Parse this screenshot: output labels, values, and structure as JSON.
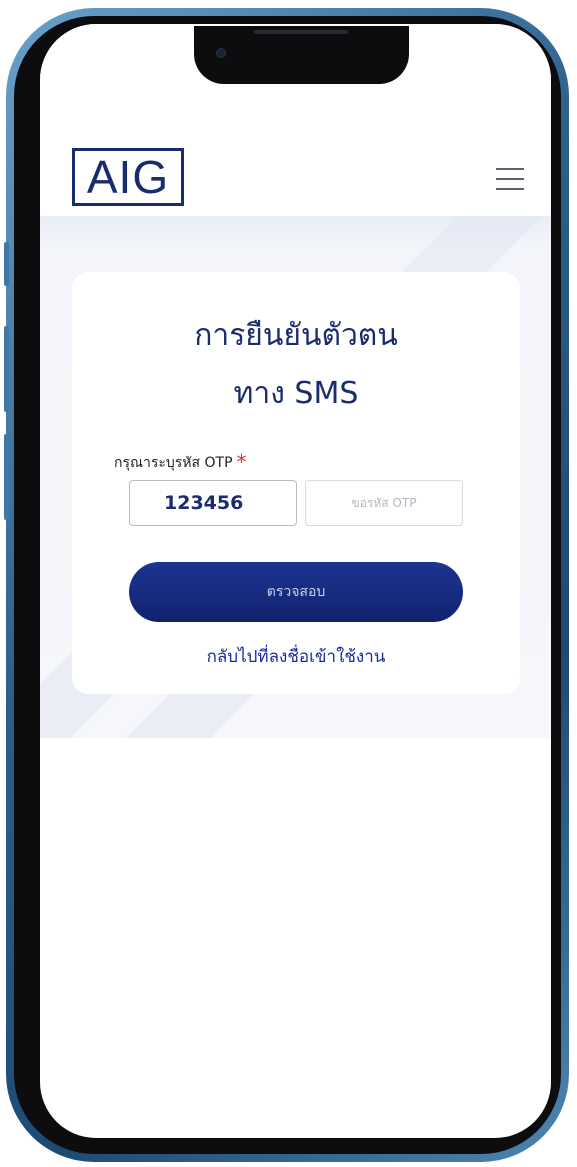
{
  "brand": {
    "logo_text": "AIG",
    "accent_color": "#1a2b6e"
  },
  "header": {
    "menu_icon": "hamburger-menu-icon"
  },
  "card": {
    "title_line1": "การยืนยันตัวตน",
    "title_line2": "ทาง SMS",
    "otp_label": "กรุณาระบุรหัส OTP",
    "required_mark": "*",
    "otp_value": "123456",
    "request_otp_label": "ขอรหัส OTP",
    "verify_button_label": "ตรวจสอบ",
    "back_link_label": "กลับไปที่ลงชื่อเข้าใช้งาน"
  }
}
